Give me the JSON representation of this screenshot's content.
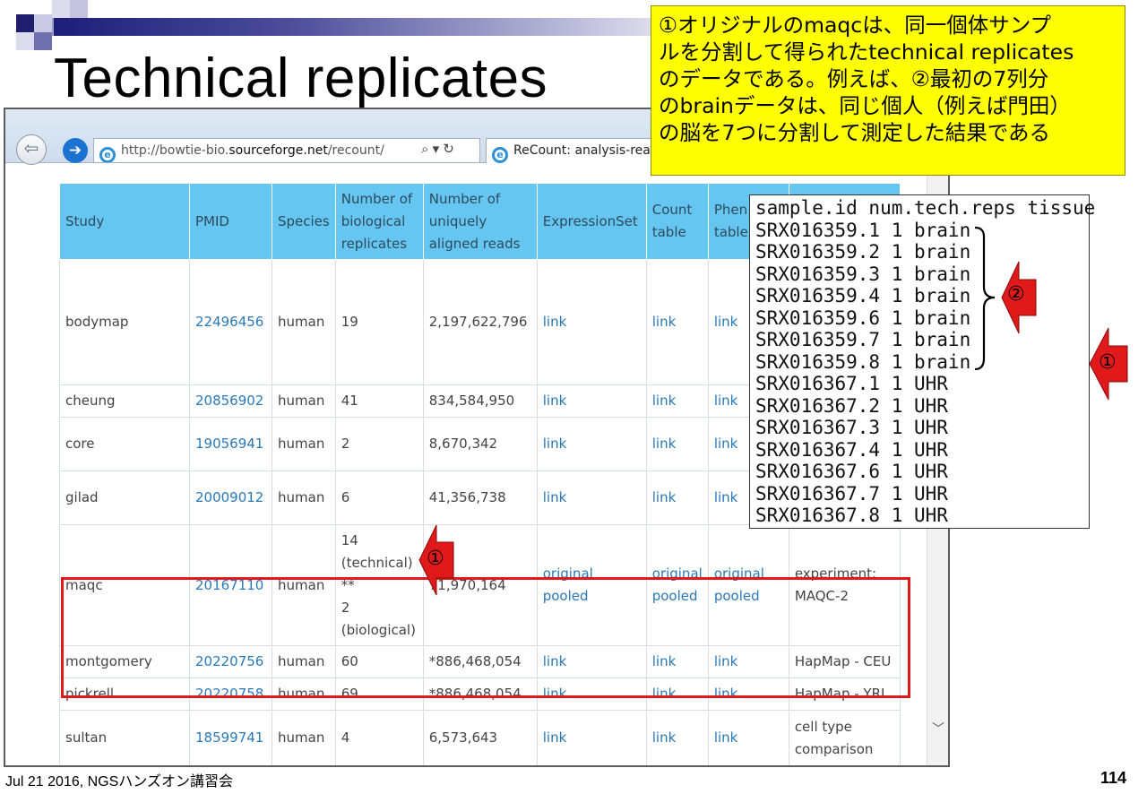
{
  "slide": {
    "title": "Technical replicates",
    "footer_left": "Jul 21 2016, NGSハンズオン講習会",
    "page_number": "114"
  },
  "browser": {
    "url_prefix": "http://bowtie-bio.",
    "url_domain": "sourceforge.net",
    "url_suffix": "/recount/",
    "addr_controls": "⌕ ▾ ↻",
    "tab_title": "ReCount: analysis-rea"
  },
  "table": {
    "headers": [
      [
        "Study"
      ],
      [
        "PMID"
      ],
      [
        "Species"
      ],
      [
        "Number of",
        "biological",
        "replicates"
      ],
      [
        "Number of",
        "uniquely",
        "aligned reads"
      ],
      [
        "ExpressionSet"
      ],
      [
        "Count",
        "table"
      ],
      [
        "Phen",
        "table"
      ],
      [
        ""
      ]
    ],
    "rows": [
      {
        "study": "bodymap",
        "pmid": "22496456",
        "species": "human",
        "replicates": [
          "19"
        ],
        "reads": "2,197,622,796",
        "eset": [
          "link"
        ],
        "count": [
          "link"
        ],
        "pheno": [
          "link"
        ],
        "notes": [
          ""
        ]
      },
      {
        "study": "cheung",
        "pmid": "20856902",
        "species": "human",
        "replicates": [
          "41"
        ],
        "reads": "834,584,950",
        "eset": [
          "link"
        ],
        "count": [
          "link"
        ],
        "pheno": [
          "link"
        ],
        "notes": [
          ""
        ]
      },
      {
        "study": "core",
        "pmid": "19056941",
        "species": "human",
        "replicates": [
          "2"
        ],
        "reads": "8,670,342",
        "eset": [
          "link"
        ],
        "count": [
          "link"
        ],
        "pheno": [
          "link"
        ],
        "notes": [
          ""
        ]
      },
      {
        "study": "gilad",
        "pmid": "20009012",
        "species": "human",
        "replicates": [
          "6"
        ],
        "reads": "41,356,738",
        "eset": [
          "link"
        ],
        "count": [
          "link"
        ],
        "pheno": [
          "link"
        ],
        "notes": [
          ""
        ]
      },
      {
        "study": "maqc",
        "pmid": "20167110",
        "species": "human",
        "replicates": [
          "14",
          "(technical)",
          "**",
          "2",
          "(biological)"
        ],
        "reads": "71,970,164",
        "eset": [
          "original",
          "pooled"
        ],
        "count": [
          "original",
          "pooled"
        ],
        "pheno": [
          "original",
          "pooled"
        ],
        "notes": [
          "experiment:",
          "MAQC-2"
        ]
      },
      {
        "study": "montgomery",
        "pmid": "20220756",
        "species": "human",
        "replicates": [
          "60"
        ],
        "reads": "*886,468,054",
        "eset": [
          "link"
        ],
        "count": [
          "link"
        ],
        "pheno": [
          "link"
        ],
        "notes": [
          "HapMap - CEU"
        ]
      },
      {
        "study": "pickrell",
        "pmid": "20220758",
        "species": "human",
        "replicates": [
          "69"
        ],
        "reads": "*886,468,054",
        "eset": [
          "link"
        ],
        "count": [
          "link"
        ],
        "pheno": [
          "link"
        ],
        "notes": [
          "HapMap - YRI"
        ]
      },
      {
        "study": "sultan",
        "pmid": "18599741",
        "species": "human",
        "replicates": [
          "4"
        ],
        "reads": "6,573,643",
        "eset": [
          "link"
        ],
        "count": [
          "link"
        ],
        "pheno": [
          "link"
        ],
        "notes": [
          "cell type",
          "comparison"
        ]
      }
    ]
  },
  "note": {
    "lines": [
      "①オリジナルのmaqcは、同一個体サンプ",
      "ルを分割して得られたtechnical replicates",
      "のデータである。例えば、②最初の7列分",
      "のbrainデータは、同じ個人（例えば門田）",
      "の脳を7つに分割して測定した結果である"
    ]
  },
  "samples": {
    "header": "sample.id num.tech.reps tissue",
    "lines": [
      "SRX016359.1 1 brain",
      "SRX016359.2 1 brain",
      "SRX016359.3 1 brain",
      "SRX016359.4 1 brain",
      "SRX016359.6 1 brain",
      "SRX016359.7 1 brain",
      "SRX016359.8 1 brain",
      "SRX016367.1 1 UHR",
      "SRX016367.2 1 UHR",
      "SRX016367.3 1 UHR",
      "SRX016367.4 1 UHR",
      "SRX016367.6 1 UHR",
      "SRX016367.7 1 UHR",
      "SRX016367.8 1 UHR"
    ]
  },
  "markers": {
    "one": "①",
    "two": "②"
  },
  "colors": {
    "header_bg": "#66c6f2",
    "link": "#2a78b8",
    "highlight_border": "#e0191b",
    "note_bg": "#ffff00",
    "arrow": "#e0191b"
  }
}
